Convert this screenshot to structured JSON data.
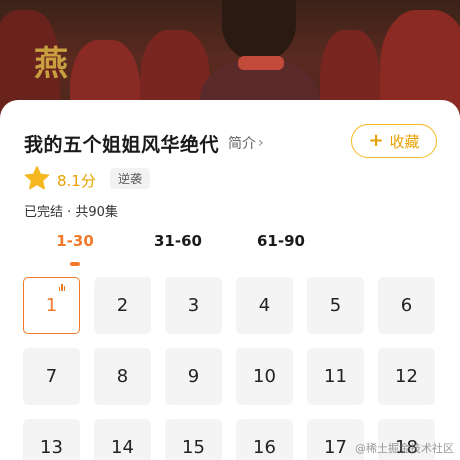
{
  "hero": {
    "logo_glyph": "燕"
  },
  "drama": {
    "title": "我的五个姐姐风华绝代",
    "intro_label": "简介",
    "collect_label": "收藏",
    "score": "8.1分",
    "genre": "逆袭",
    "status": "已完结 · 共90集"
  },
  "range_tabs": [
    "1-30",
    "31-60",
    "61-90"
  ],
  "active_range": 0,
  "episodes": [
    "1",
    "2",
    "3",
    "4",
    "5",
    "6",
    "7",
    "8",
    "9",
    "10",
    "11",
    "12",
    "13",
    "14",
    "15",
    "16",
    "17",
    "18"
  ],
  "active_episode": 0,
  "colors": {
    "accent": "#f07a2a",
    "gold": "#e8a200",
    "star": "#f5b820"
  },
  "watermark": "@稀土掘金技术社区"
}
